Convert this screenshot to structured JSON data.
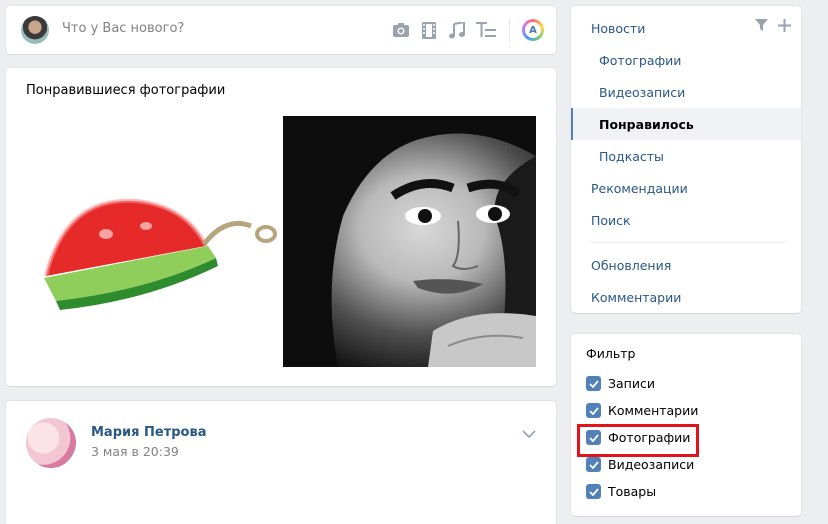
{
  "composer": {
    "placeholder": "Что у Вас нового?",
    "icons": [
      "camera-icon",
      "video-icon",
      "music-icon",
      "text-format-icon",
      "aa-style-icon"
    ]
  },
  "liked": {
    "title": "Понравившиеся фотографии"
  },
  "post": {
    "author": "Мария Петрова",
    "date": "3 мая в 20:39"
  },
  "nav": {
    "items": [
      {
        "label": "Новости",
        "level": "top"
      },
      {
        "label": "Фотографии",
        "level": "sub"
      },
      {
        "label": "Видеозаписи",
        "level": "sub"
      },
      {
        "label": "Понравилось",
        "level": "sub",
        "active": true
      },
      {
        "label": "Подкасты",
        "level": "sub"
      },
      {
        "label": "Рекомендации",
        "level": "top"
      },
      {
        "label": "Поиск",
        "level": "top"
      },
      {
        "label": "Обновления",
        "level": "top"
      },
      {
        "label": "Комментарии",
        "level": "top"
      }
    ]
  },
  "filter": {
    "title": "Фильтр",
    "options": [
      {
        "label": "Записи",
        "checked": true
      },
      {
        "label": "Комментарии",
        "checked": true
      },
      {
        "label": "Фотографии",
        "checked": true
      },
      {
        "label": "Видеозаписи",
        "checked": true
      },
      {
        "label": "Товары",
        "checked": true
      }
    ]
  },
  "colors": {
    "accent": "#5181b8",
    "link": "#2a5885",
    "highlight": "#e3121b",
    "background": "#edeef0"
  }
}
